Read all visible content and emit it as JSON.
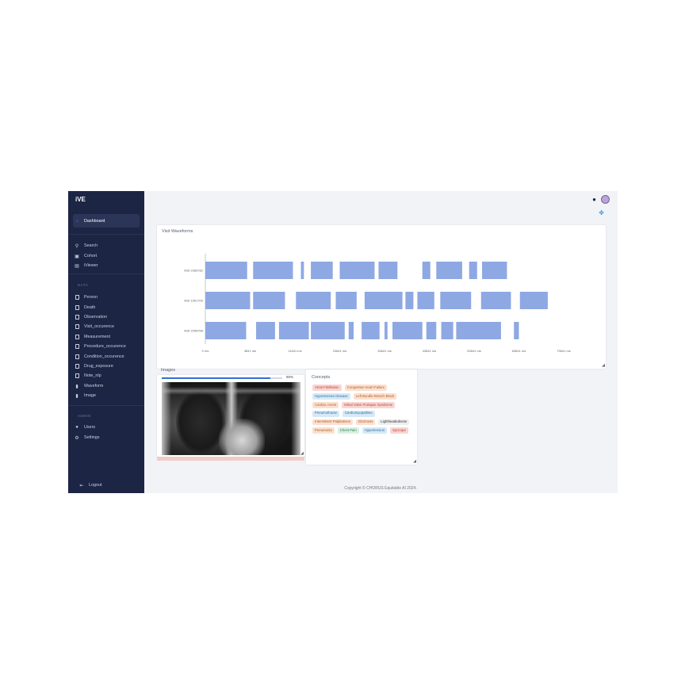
{
  "app": {
    "brand": "iVE"
  },
  "sidebar": {
    "main": [
      {
        "label": "Dashboard",
        "icon": "home-icon",
        "active": true
      }
    ],
    "tools": [
      {
        "label": "Search",
        "icon": "search-icon"
      },
      {
        "label": "Cohort",
        "icon": "cohort-icon"
      },
      {
        "label": "iViewer",
        "icon": "viewer-icon"
      }
    ],
    "data_label": "DATA",
    "data_items": [
      {
        "label": "Person"
      },
      {
        "label": "Death"
      },
      {
        "label": "Observation"
      },
      {
        "label": "Visit_occurence"
      },
      {
        "label": "Measurement"
      },
      {
        "label": "Procedure_occurence"
      },
      {
        "label": "Condition_occurence"
      },
      {
        "label": "Drug_exposure"
      },
      {
        "label": "Note_nlp"
      },
      {
        "label": "Waveform"
      },
      {
        "label": "Image"
      }
    ],
    "admin_label": "ADMIN",
    "admin_items": [
      {
        "label": "Users",
        "icon": "user-icon"
      },
      {
        "label": "Settings",
        "icon": "gear-icon"
      }
    ],
    "logout": "Logout"
  },
  "waveforms": {
    "title": "Visit Waveforms",
    "rows": [
      {
        "label": "Visit 2366782",
        "segments": [
          [
            0,
            4200
          ],
          [
            4800,
            8800
          ],
          [
            9600,
            9900
          ],
          [
            10600,
            12800
          ],
          [
            13500,
            17000
          ],
          [
            17400,
            19300
          ],
          [
            21800,
            22600
          ],
          [
            23200,
            25800
          ],
          [
            26500,
            27300
          ],
          [
            27800,
            30300
          ]
        ]
      },
      {
        "label": "Visit 1561700",
        "segments": [
          [
            0,
            4500
          ],
          [
            4800,
            8000
          ],
          [
            9100,
            12600
          ],
          [
            13100,
            15200
          ],
          [
            16000,
            19800
          ],
          [
            20100,
            20900
          ],
          [
            21300,
            23000
          ],
          [
            23600,
            26700
          ],
          [
            27700,
            30700
          ],
          [
            31600,
            34400
          ]
        ]
      },
      {
        "label": "Visit 2098768",
        "segments": [
          [
            0,
            4100
          ],
          [
            5100,
            7000
          ],
          [
            7400,
            10400
          ],
          [
            10600,
            14000
          ],
          [
            14400,
            14900
          ],
          [
            15700,
            17500
          ],
          [
            18000,
            18300
          ],
          [
            18800,
            21800
          ],
          [
            22200,
            23200
          ],
          [
            23700,
            24900
          ],
          [
            25200,
            29700
          ],
          [
            31000,
            31500
          ]
        ]
      }
    ],
    "x_ticks": [
      "0 ms",
      "3841 ms",
      "11841 ms",
      "23841 ms",
      "33841 ms",
      "43841 ms",
      "53841 ms",
      "63841 ms",
      "73841 ms"
    ],
    "x_max": 36000,
    "bar_color": "#8ea8e3"
  },
  "images": {
    "title": "Images",
    "progress_percent": 90,
    "progress_text": "90%"
  },
  "concepts": {
    "title": "Concepts",
    "tags": [
      {
        "label": "Atrial Fibrillation",
        "bg": "#f9d5d2",
        "fg": "#b2453c"
      },
      {
        "label": "Congestive Heart Failure",
        "bg": "#fbe0cf",
        "fg": "#b35a26"
      },
      {
        "label": "Hypertensive Disease",
        "bg": "#d6e9f7",
        "fg": "#2f6f9f"
      },
      {
        "label": "Left Bundle-Branch Block",
        "bg": "#fbe0cf",
        "fg": "#b35a26"
      },
      {
        "label": "Cardiac Arrest",
        "bg": "#fbe0cf",
        "fg": "#b35a26"
      },
      {
        "label": "Mitral Valve Prolapse Syndrome",
        "bg": "#f9d5d2",
        "fg": "#b2453c"
      },
      {
        "label": "Pneumothorax",
        "bg": "#d6e9f7",
        "fg": "#2f6f9f"
      },
      {
        "label": "Cardiomyopathies",
        "bg": "#d6e9f7",
        "fg": "#2f6f9f"
      },
      {
        "label": "Intermittent Palpitations",
        "bg": "#fbe0cf",
        "fg": "#b35a26"
      },
      {
        "label": "Dizziness",
        "bg": "#fbe0cf",
        "fg": "#b35a26"
      },
      {
        "label": "Lightheadedness",
        "bg": "#eeeeee",
        "fg": "#333333"
      },
      {
        "label": "Pneumonia",
        "bg": "#fbe0cf",
        "fg": "#b35a26"
      },
      {
        "label": "Chest Pain",
        "bg": "#d8f0e2",
        "fg": "#2f7d52"
      },
      {
        "label": "Hypertension",
        "bg": "#d6e9f7",
        "fg": "#2f6f9f"
      },
      {
        "label": "Syncope",
        "bg": "#f9d5d2",
        "fg": "#b2453c"
      }
    ]
  },
  "footer": "Copyright © CHORUS Equitable AI 2024."
}
